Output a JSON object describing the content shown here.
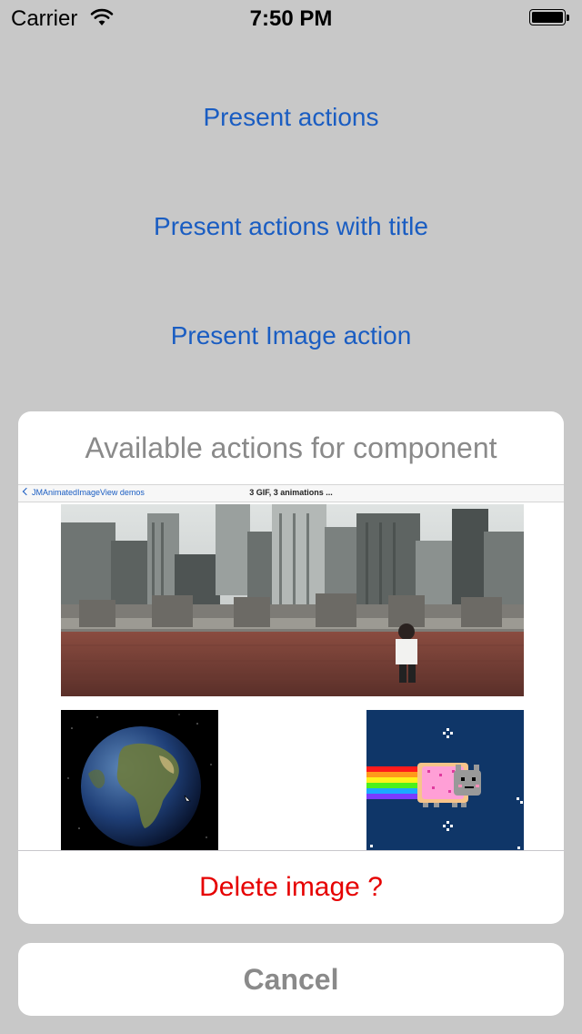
{
  "status_bar": {
    "carrier": "Carrier",
    "time": "7:50 PM"
  },
  "menu": {
    "present_actions": "Present actions",
    "present_actions_with_title": "Present actions with title",
    "present_image_action": "Present Image action"
  },
  "action_sheet": {
    "title": "Available actions for component",
    "preview": {
      "back_label": "JMAnimatedImageView demos",
      "nav_title": "3 GIF, 3 animations ..."
    },
    "destructive_action": "Delete image ?",
    "cancel": "Cancel"
  },
  "colors": {
    "background": "#c8c8c8",
    "link_blue": "#1a5dc2",
    "destructive_red": "#e60000",
    "muted_gray": "#8a8a8a"
  }
}
